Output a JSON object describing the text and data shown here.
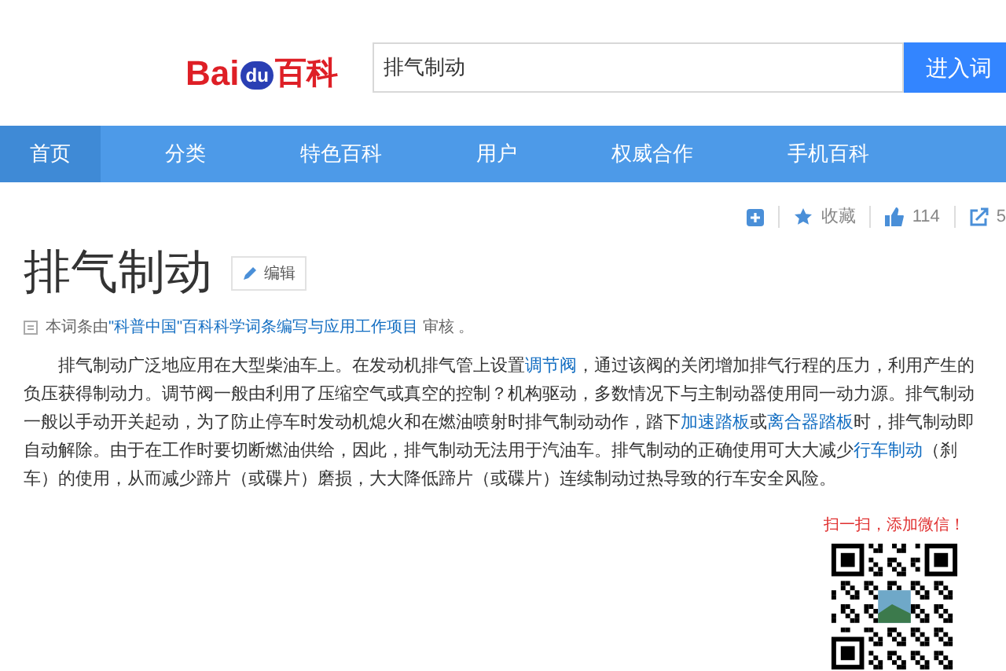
{
  "header": {
    "logo": {
      "left": "Bai",
      "paw": "du",
      "right": "百科"
    },
    "search": {
      "value": "排气制动"
    },
    "search_button": "进入词"
  },
  "nav": [
    {
      "label": "首页",
      "selected": true
    },
    {
      "label": "分类",
      "selected": false
    },
    {
      "label": "特色百科",
      "selected": false
    },
    {
      "label": "用户",
      "selected": false
    },
    {
      "label": "权威合作",
      "selected": false
    },
    {
      "label": "手机百科",
      "selected": false
    }
  ],
  "tools": {
    "favorite": "收藏",
    "likes": "114",
    "shares": "5"
  },
  "title": "排气制动",
  "edit_button": "编辑",
  "review_note": [
    {
      "text": "本词条由",
      "link": false
    },
    {
      "text": "\"科普中国\"百科科学词条编写与应用工作项目",
      "link": true
    },
    {
      "text": " 审核 。",
      "link": false
    }
  ],
  "paragraph": [
    {
      "text": "排气制动广泛地应用在大型柴油车上。在发动机排气管上设置",
      "link": false
    },
    {
      "text": "调节阀",
      "link": true
    },
    {
      "text": "，通过该阀的关闭增加排气行程的压力，利用产生的负压获得制动力。调节阀一般由利用了压缩空气或真空的控制？机构驱动，多数情况下与主制动器使用同一动力源。排气制动一般以手动开关起动，为了防止停车时发动机熄火和在燃油喷射时排气制动动作，踏下",
      "link": false
    },
    {
      "text": "加速踏板",
      "link": true
    },
    {
      "text": "或",
      "link": false
    },
    {
      "text": "离合器踏板",
      "link": true
    },
    {
      "text": "时，排气制动即自动解除。由于在工作时要切断燃油供给，因此，排气制动无法用于汽油车。排气制动的正确使用可大大减少",
      "link": false
    },
    {
      "text": "行车制动",
      "link": true
    },
    {
      "text": "（刹车）的使用，从而减少蹄片（或碟片）磨损，大大降低蹄片（或碟片）连续制动过热导致的行车安全风险。",
      "link": false
    }
  ],
  "qr": {
    "caption": "扫一扫，添加微信！"
  }
}
